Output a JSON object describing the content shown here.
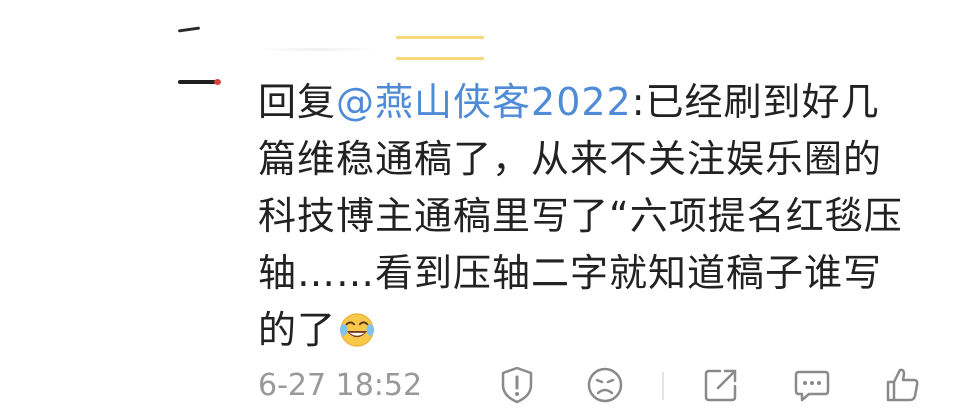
{
  "comment": {
    "prefix": "回复",
    "mention": "@燕山侠客2022",
    "colon": ":",
    "body": "已经刷到好几篇维稳通稿了，从来不关注娱乐圈的科技博主通稿里写了“六项提名红毯压轴……看到压轴二字就知道稿子谁写的了"
  },
  "footer": {
    "timestamp": "6-27 18:52"
  },
  "icons": {
    "report": "exclamation-shield-icon",
    "dislike": "sad-face-icon",
    "share": "share-icon",
    "reply": "comment-bubble-icon",
    "like": "thumbs-up-icon",
    "emoji": "laugh-cry-emoji"
  },
  "colors": {
    "text": "#222222",
    "mention": "#4f8bd6",
    "muted": "#999999",
    "icon": "#8a8a8a"
  }
}
